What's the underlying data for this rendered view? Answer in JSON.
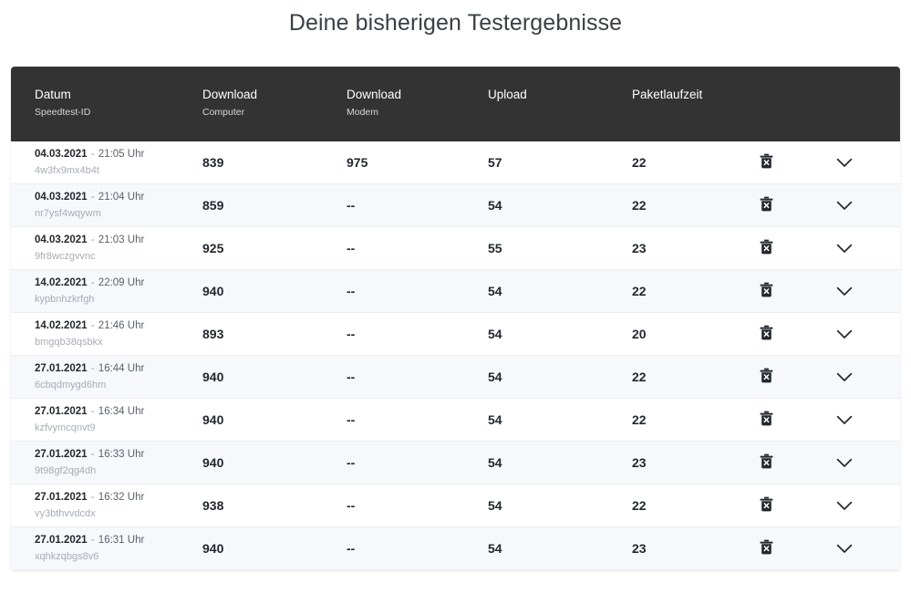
{
  "page": {
    "title": "Deine bisherigen Testergebnisse",
    "background_color": "#ffffff",
    "title_color": "#3a3f45"
  },
  "table": {
    "header_background": "#333333",
    "header_text_color": "#ffffff",
    "stripe_color": "#f6f8fc",
    "row_border_color": "#ebedf2",
    "columns": [
      {
        "main": "Datum",
        "sub": "Speedtest-ID"
      },
      {
        "main": "Download",
        "sub": "Computer"
      },
      {
        "main": "Download",
        "sub": "Modem"
      },
      {
        "main": "Upload",
        "sub": ""
      },
      {
        "main": "Paketlaufzeit",
        "sub": ""
      },
      {
        "main": "",
        "sub": ""
      },
      {
        "main": "",
        "sub": ""
      }
    ],
    "time_suffix": "Uhr",
    "separator": "-",
    "delete_icon_label": "trash-icon",
    "expand_icon_label": "chevron-down-icon",
    "rows": [
      {
        "date": "04.03.2021",
        "time": "21:05",
        "speedtest_id": "4w3fx9mx4b4t",
        "download_computer": "839",
        "download_modem": "975",
        "upload": "57",
        "paketlaufzeit": "22"
      },
      {
        "date": "04.03.2021",
        "time": "21:04",
        "speedtest_id": "nr7ysf4wqywm",
        "download_computer": "859",
        "download_modem": "--",
        "upload": "54",
        "paketlaufzeit": "22"
      },
      {
        "date": "04.03.2021",
        "time": "21:03",
        "speedtest_id": "9fr8wczgvvnc",
        "download_computer": "925",
        "download_modem": "--",
        "upload": "55",
        "paketlaufzeit": "23"
      },
      {
        "date": "14.02.2021",
        "time": "22:09",
        "speedtest_id": "kypbnhzkrfgh",
        "download_computer": "940",
        "download_modem": "--",
        "upload": "54",
        "paketlaufzeit": "22"
      },
      {
        "date": "14.02.2021",
        "time": "21:46",
        "speedtest_id": "bmgqb38qsbkx",
        "download_computer": "893",
        "download_modem": "--",
        "upload": "54",
        "paketlaufzeit": "20"
      },
      {
        "date": "27.01.2021",
        "time": "16:44",
        "speedtest_id": "6cbqdmygd6hm",
        "download_computer": "940",
        "download_modem": "--",
        "upload": "54",
        "paketlaufzeit": "22"
      },
      {
        "date": "27.01.2021",
        "time": "16:34",
        "speedtest_id": "kzfvymcqnvt9",
        "download_computer": "940",
        "download_modem": "--",
        "upload": "54",
        "paketlaufzeit": "22"
      },
      {
        "date": "27.01.2021",
        "time": "16:33",
        "speedtest_id": "9t98gf2qg4dh",
        "download_computer": "940",
        "download_modem": "--",
        "upload": "54",
        "paketlaufzeit": "23"
      },
      {
        "date": "27.01.2021",
        "time": "16:32",
        "speedtest_id": "vy3bthvvdcdx",
        "download_computer": "938",
        "download_modem": "--",
        "upload": "54",
        "paketlaufzeit": "22"
      },
      {
        "date": "27.01.2021",
        "time": "16:31",
        "speedtest_id": "xqhkzqbgs8v6",
        "download_computer": "940",
        "download_modem": "--",
        "upload": "54",
        "paketlaufzeit": "23"
      }
    ]
  }
}
